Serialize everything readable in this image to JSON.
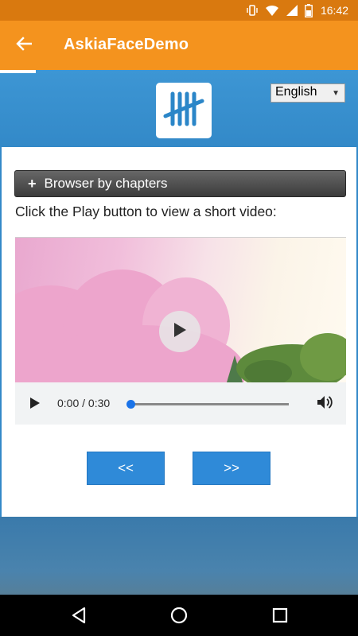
{
  "status_bar": {
    "time": "16:42"
  },
  "app_bar": {
    "title": "AskiaFaceDemo"
  },
  "language_select": {
    "selected": "English"
  },
  "chapters_bar": {
    "label": "Browser by chapters"
  },
  "instruction": {
    "text": "Click the Play button to view a short video:"
  },
  "video": {
    "time_display": "0:00 / 0:30",
    "progress": 0.0
  },
  "nav_buttons": {
    "prev_label": "<<",
    "next_label": ">>"
  },
  "colors": {
    "app_bar": "#f4931e",
    "status_bar": "#d9790f",
    "brand_band": "#3389c8",
    "nav_button": "#2f8ad8",
    "chapters_bar": "#4a4a4a",
    "slider_thumb": "#1a73e8"
  }
}
